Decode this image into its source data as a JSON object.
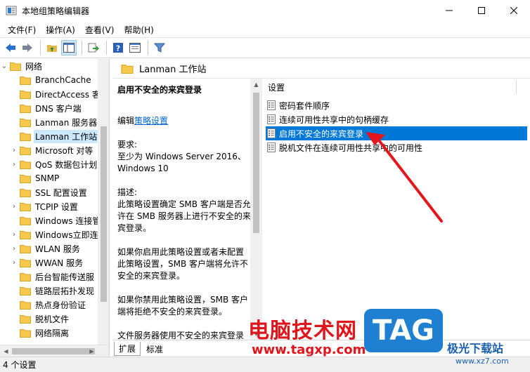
{
  "window": {
    "title": "本地组策略编辑器",
    "minimize": "—",
    "maximize": "☐",
    "close": "✕"
  },
  "menu": [
    "文件(F)",
    "操作(A)",
    "查看(V)",
    "帮助(H)"
  ],
  "toolbar": {
    "icons": [
      "back-icon",
      "forward-icon",
      "up-folder-icon",
      "show-hide-tree-icon",
      "export-list-icon",
      "help-icon",
      "view-pane-icon",
      "filter-icon"
    ]
  },
  "tree": {
    "root": "网络",
    "items": [
      {
        "label": "BranchCache",
        "expandable": false
      },
      {
        "label": "DirectAccess 客",
        "expandable": false
      },
      {
        "label": "DNS 客户端",
        "expandable": false
      },
      {
        "label": "Lanman 服务器",
        "expandable": false
      },
      {
        "label": "Lanman 工作站",
        "expandable": false,
        "selected": true
      },
      {
        "label": "Microsoft 对等",
        "expandable": true
      },
      {
        "label": "QoS 数据包计划",
        "expandable": true
      },
      {
        "label": "SNMP",
        "expandable": false
      },
      {
        "label": "SSL 配置设置",
        "expandable": false
      },
      {
        "label": "TCPIP 设置",
        "expandable": true
      },
      {
        "label": "Windows 连接管",
        "expandable": false
      },
      {
        "label": "Windows立即连",
        "expandable": true
      },
      {
        "label": "WLAN 服务",
        "expandable": true
      },
      {
        "label": "WWAN 服务",
        "expandable": true
      },
      {
        "label": "后台智能传送服",
        "expandable": false
      },
      {
        "label": "链路层拓扑发现",
        "expandable": false
      },
      {
        "label": "热点身份验证",
        "expandable": false
      },
      {
        "label": "脱机文件",
        "expandable": false
      },
      {
        "label": "网络隔离",
        "expandable": false
      }
    ]
  },
  "right": {
    "header": "Lanman 工作站",
    "description": {
      "title": "启用不安全的来宾登录",
      "edit_prefix": "编辑",
      "edit_link": "策略设置",
      "requirements_label": "要求:",
      "requirements_text": "至少为 Windows Server 2016、Windows 10",
      "desc_label": "描述:",
      "desc_text": "此策略设置确定 SMB 客户端是否允许在 SMB 服务器上进行不安全的来宾登录。",
      "enabled_text": "如果你启用此策略设置或者未配置此策略设置，SMB 客户端将允许不安全的来宾登录。",
      "disabled_text": "如果你禁用此策略设置，SMB 客户端将拒绝不安全的来宾登录。",
      "more_text": "文件服务器使用不安全的来宾登录允许对共享文件夹进行未经身份验证的访问。"
    },
    "list_header": "设置",
    "settings": [
      {
        "label": "密码套件顺序",
        "selected": false
      },
      {
        "label": "连续可用性共享中的句柄缓存",
        "selected": false
      },
      {
        "label": "启用不安全的来宾登录",
        "selected": true
      },
      {
        "label": "脱机文件在连续可用性共享中的可用性",
        "selected": false
      }
    ],
    "tabs": [
      "扩展",
      "标准"
    ]
  },
  "status": "4 个设置",
  "watermark": {
    "main": "电脑技术网",
    "url": "www.tagxp.com",
    "tag": "TAG",
    "site": "极光下载站",
    "site_url": "www.xz7.com"
  },
  "colors": {
    "selection": "#0078d7",
    "tree_selection": "#cce8ff",
    "arrow": "#e3161b",
    "link": "#0066cc"
  }
}
